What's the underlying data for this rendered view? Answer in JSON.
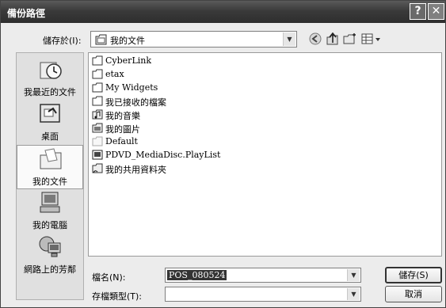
{
  "window": {
    "title": "備份路徑",
    "help_glyph": "?",
    "close_glyph": "✕"
  },
  "save_in": {
    "label": "儲存於(I):",
    "value": "我的文件",
    "icon": "documents-folder-icon"
  },
  "toolbar": {
    "icons": [
      "back-icon",
      "up-folder-icon",
      "new-folder-icon",
      "view-menu-icon"
    ]
  },
  "places": [
    {
      "label": "我最近的文件",
      "icon": "recent-documents-icon",
      "selected": false
    },
    {
      "label": "桌面",
      "icon": "desktop-icon",
      "selected": false
    },
    {
      "label": "我的文件",
      "icon": "my-documents-icon",
      "selected": true
    },
    {
      "label": "我的電腦",
      "icon": "my-computer-icon",
      "selected": false
    },
    {
      "label": "網路上的芳鄰",
      "icon": "network-places-icon",
      "selected": false
    }
  ],
  "files": [
    {
      "name": "CyberLink",
      "icon": "folder-icon"
    },
    {
      "name": "etax",
      "icon": "folder-icon"
    },
    {
      "name": "My Widgets",
      "icon": "folder-icon"
    },
    {
      "name": "我已接收的檔案",
      "icon": "folder-icon"
    },
    {
      "name": "我的音樂",
      "icon": "music-folder-icon"
    },
    {
      "name": "我的圖片",
      "icon": "pictures-folder-icon"
    },
    {
      "name": "Default",
      "icon": "default-folder-icon"
    },
    {
      "name": "PDVD_MediaDisc.PlayList",
      "icon": "playlist-file-icon"
    },
    {
      "name": "我的共用資料夾",
      "icon": "shared-folder-icon"
    }
  ],
  "filename": {
    "label": "檔名(N):",
    "value": "POS_080524"
  },
  "filetype": {
    "label": "存檔類型(T):",
    "value": ""
  },
  "buttons": {
    "save": "儲存(S)",
    "cancel": "取消"
  },
  "colors": {
    "titlebar": "#3a3a3a",
    "dialog_bg": "#ececec",
    "selection": "#333333"
  }
}
